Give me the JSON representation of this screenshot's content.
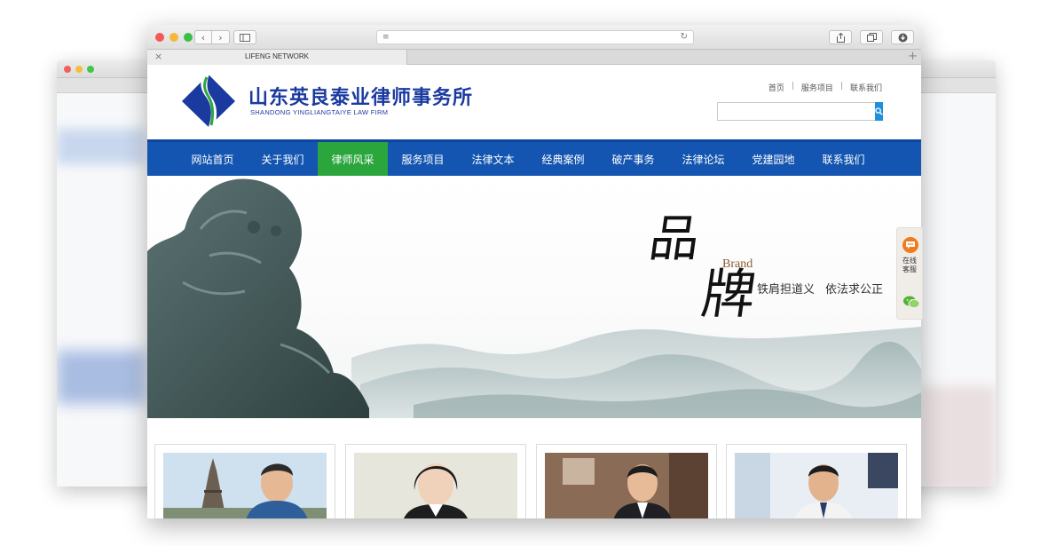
{
  "browser": {
    "tab_title": "LIFENG NETWORK",
    "tab_close": "×",
    "new_tab": "+",
    "back": "‹",
    "forward": "›"
  },
  "header": {
    "name_cn": "山东英良泰业律师事务所",
    "name_en": "SHANDONG YINGLIANGTAIYE LAW FIRM",
    "top_links": [
      "首页",
      "服务项目",
      "联系我们"
    ],
    "top_sep": "|"
  },
  "nav": {
    "items": [
      "网站首页",
      "关于我们",
      "律师风采",
      "服务项目",
      "法律文本",
      "经典案例",
      "破产事务",
      "法律论坛",
      "党建园地",
      "联系我们"
    ],
    "active_index": 2
  },
  "banner": {
    "calligraphy_1": "品",
    "calligraphy_2": "牌",
    "brand_word": "Brand",
    "slogan_a": "铁肩担道义",
    "slogan_b": "依法求公正"
  },
  "float_widget": {
    "label_1": "在线",
    "label_2": "客服"
  },
  "colors": {
    "nav_bg": "#1355b0",
    "nav_active": "#2aa63d",
    "brand_blue": "#1b3aa0",
    "search_btn": "#1f8fdc",
    "chat_orange": "#f17a1d"
  }
}
